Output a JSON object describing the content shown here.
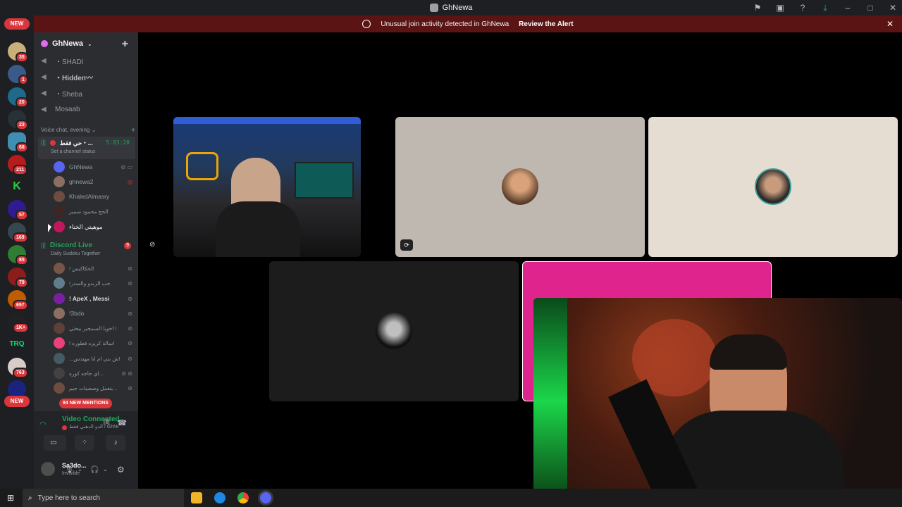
{
  "window": {
    "title": "GhNewa"
  },
  "alert": {
    "text": "Unusual join activity detected in GhNewa",
    "action": "Review the Alert"
  },
  "rail": {
    "new_top": "NEW",
    "new_bottom": "NEW",
    "badges": [
      "35",
      "1",
      "20",
      "23",
      "68",
      "211",
      "57",
      "169",
      "85",
      "79",
      "657",
      "1K+",
      "763",
      "917"
    ]
  },
  "guild": {
    "name": "GhNewa"
  },
  "channels": {
    "text": [
      {
        "label": "・SHADI"
      },
      {
        "label": "・Hidden〰"
      },
      {
        "label": "・Sheba"
      },
      {
        "label": "Mosaab"
      }
    ],
    "category": "Voice chat, evening",
    "active_voice": {
      "name": "حي فقط・...",
      "timer": "5:03:20",
      "status": "Set a channel status"
    },
    "voice_users": [
      {
        "name": "GhNewa",
        "color": "#5865f2"
      },
      {
        "name": "ghnewa2",
        "color": "#8d6e63"
      },
      {
        "name": "KhaledAlmasry",
        "color": "#6d4c41"
      },
      {
        "name": "الحج محمود سمير",
        "color": "#3e2723"
      },
      {
        "name": "موهيتي الخناء",
        "color": "#c2185b"
      }
    ],
    "discord_live": {
      "name": "Discord Live",
      "subtitle": "Daily Sudoku Together",
      "count": "9"
    },
    "live_users": [
      {
        "name": "! الحكاكيس",
        "color": "#795548"
      },
      {
        "name": "!حب الزبدو والسدر",
        "color": "#607d8b"
      },
      {
        "name": "! ApeX , Messi",
        "color": "#7b1fa2"
      },
      {
        "name": "!3bdo",
        "color": "#8d6e63"
      },
      {
        "name": "اخويا السمجير بيحتي !",
        "color": "#5d4037"
      },
      {
        "name": "! اسالة كريزه فطوره",
        "color": "#ec407a"
      },
      {
        "name": "...ش بتي ام انا مهندس!",
        "color": "#455a64"
      },
      {
        "name": "اي حاجه كورة...",
        "color": "#424242"
      },
      {
        "name": "بتعمل وصصيات جيم...",
        "color": "#6d4c41"
      }
    ],
    "mentions": "84 NEW MENTIONS"
  },
  "voice_panel": {
    "status": "Video Connected",
    "channel": "الدو الدهني فقط / GhNe...",
    "user": "Sa3do...",
    "presence": "Invisible"
  },
  "taskbar": {
    "search_placeholder": "Type here to search"
  },
  "colors": {
    "accent_green": "#23a559",
    "danger": "#da373c",
    "alert_bg": "#5a1414",
    "pink_tile": "#e0248e"
  }
}
